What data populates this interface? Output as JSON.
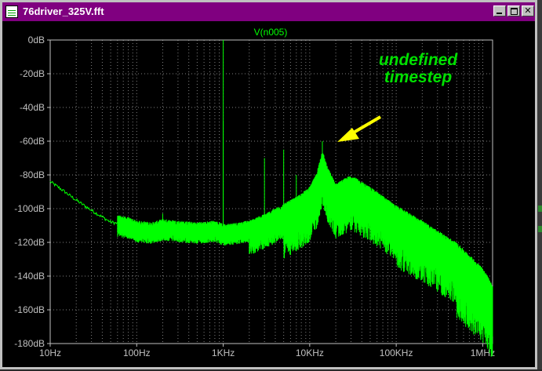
{
  "window": {
    "title": "76driver_325V.fft"
  },
  "trace": {
    "name": "V(n005)",
    "color": "#00ff00"
  },
  "annotation": {
    "line1": "undefined",
    "line2": "timestep",
    "text_color": "#00e000",
    "arrow_color": "#ffff00"
  },
  "axes": {
    "x_ticks": [
      "10Hz",
      "100Hz",
      "1KHz",
      "10KHz",
      "100KHz",
      "1MHz"
    ],
    "y_ticks": [
      "0dB",
      "-20dB",
      "-40dB",
      "-60dB",
      "-80dB",
      "-100dB",
      "-120dB",
      "-140dB",
      "-160dB",
      "-180dB"
    ],
    "x_scale": "log",
    "x_range_hz": [
      10,
      1300000
    ],
    "y_range_db": [
      -180,
      0
    ],
    "grid": true
  },
  "chart_data": {
    "type": "line",
    "x_scale": "log",
    "xlabel": "",
    "ylabel": "",
    "ylim": [
      -180,
      0
    ],
    "series": [
      {
        "name": "V(n005)",
        "points_hz_db": [
          [
            10,
            -84
          ],
          [
            13,
            -88
          ],
          [
            20,
            -95
          ],
          [
            30,
            -101
          ],
          [
            50,
            -108
          ],
          [
            80,
            -110
          ],
          [
            100,
            -112
          ],
          [
            150,
            -113
          ],
          [
            200,
            -111
          ],
          [
            300,
            -112
          ],
          [
            500,
            -113
          ],
          [
            800,
            -112
          ],
          [
            1000,
            -114
          ],
          [
            1500,
            -113
          ],
          [
            2000,
            -112
          ],
          [
            3000,
            -108
          ],
          [
            5000,
            -102
          ],
          [
            7000,
            -98
          ],
          [
            10000,
            -92
          ],
          [
            12000,
            -84
          ],
          [
            14000,
            -70
          ],
          [
            16000,
            -80
          ],
          [
            20000,
            -90
          ],
          [
            30000,
            -85
          ],
          [
            50000,
            -92
          ],
          [
            100000,
            -103
          ],
          [
            200000,
            -112
          ],
          [
            500000,
            -125
          ],
          [
            1000000,
            -140
          ],
          [
            1300000,
            -150
          ]
        ]
      }
    ],
    "spikes_hz_db": [
      [
        200,
        -103
      ],
      [
        1000,
        0
      ],
      [
        1000,
        -48
      ],
      [
        3000,
        -70
      ],
      [
        5000,
        -65
      ],
      [
        7000,
        -80
      ],
      [
        14000,
        -60
      ]
    ]
  }
}
